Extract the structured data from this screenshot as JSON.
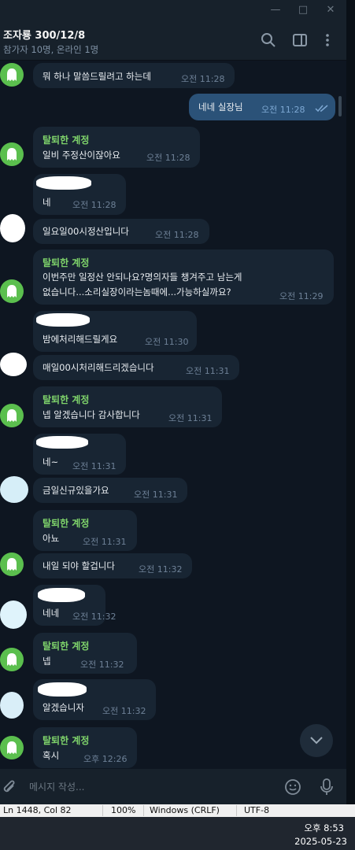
{
  "window": {
    "controls": [
      "minimize-icon",
      "maximize-icon",
      "close-icon"
    ]
  },
  "header": {
    "title": "조자룡 300/12/8",
    "subtitle": "참가자 10명, 온라인 1명"
  },
  "messages": [
    {
      "sender": "",
      "text": "뭐 하나 말씀드릴려고 하는데",
      "time": "오전 11:28"
    },
    {
      "sender": "",
      "text": "네네 실장님",
      "time": "오전 11:28",
      "outgoing": true
    },
    {
      "sender": "탈퇴한 계정",
      "text": "일비 주정산이잖아요",
      "time": "오전 11:28"
    },
    {
      "sender": "",
      "text": "네",
      "time": "오전 11:28"
    },
    {
      "sender": "",
      "text": "일요일00시정산입니다",
      "time": "오전 11:28"
    },
    {
      "sender": "탈퇴한 계정",
      "text": "이번주만 일정산 안되나요?명의자들 챙겨주고 남는게",
      "text2": "없습니다...소리실장이라는놈때에...가능하실까요?",
      "time": "오전 11:29"
    },
    {
      "sender": "",
      "text": "밤에처리해드릴게요",
      "time": "오전 11:30"
    },
    {
      "sender": "",
      "text": "매일00시처리해드리겠습니다",
      "time": "오전 11:31"
    },
    {
      "sender": "탈퇴한 계정",
      "text": "넵 알겠습니다 감사합니다",
      "time": "오전 11:31"
    },
    {
      "sender": "",
      "text": "네~",
      "time": "오전 11:31"
    },
    {
      "sender": "",
      "text": "금일신규있을가요",
      "time": "오전 11:31"
    },
    {
      "sender": "탈퇴한 계정",
      "text": "아뇨",
      "time": "오전 11:31"
    },
    {
      "sender": "",
      "text": "내일 되야 할겁니다",
      "time": "오전 11:32"
    },
    {
      "sender": "",
      "text": "네네",
      "time": "오전 11:32"
    },
    {
      "sender": "탈퇴한 계정",
      "text": "넵",
      "time": "오전 11:32"
    },
    {
      "sender": "",
      "text": "알겠습니자",
      "time": "오전 11:32"
    },
    {
      "sender": "탈퇴한 계정",
      "text": "혹시",
      "time": "오후 12:26"
    }
  ],
  "composer": {
    "placeholder": "메시지 작성..."
  },
  "statusbar": {
    "position": "Ln 1448, Col 82",
    "zoom": "100%",
    "line_ending": "Windows (CRLF)",
    "encoding": "UTF-8"
  },
  "taskbar": {
    "time": "오후 8:53",
    "date": "2025-05-23"
  },
  "colors": {
    "background": "#0e1621",
    "incoming_bubble": "#182533",
    "outgoing_bubble": "#2b5278",
    "sender_name": "#7fd46b",
    "avatar": "#5bbf4e"
  }
}
